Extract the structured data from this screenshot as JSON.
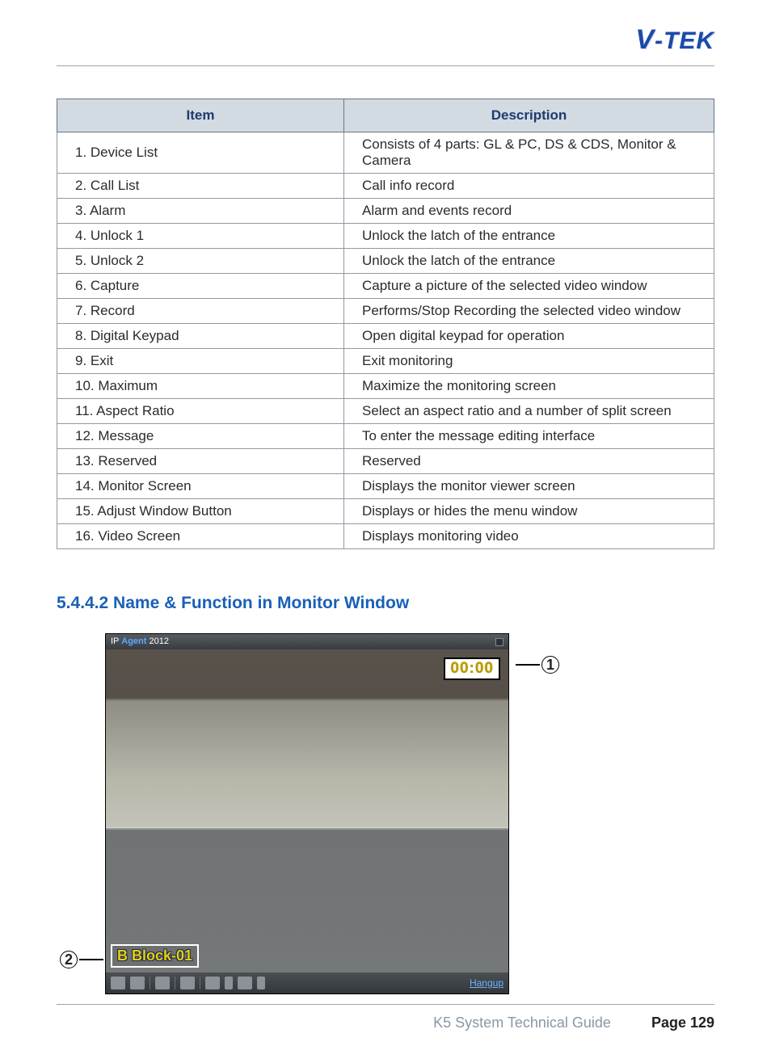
{
  "logo_text": "V-TEK",
  "table": {
    "headers": [
      "Item",
      "Description"
    ],
    "rows": [
      [
        "1. Device List",
        "Consists of 4 parts: GL & PC, DS & CDS, Monitor & Camera"
      ],
      [
        "2. Call List",
        "Call info record"
      ],
      [
        "3. Alarm",
        "Alarm and events record"
      ],
      [
        "4. Unlock 1",
        "Unlock the latch of the entrance"
      ],
      [
        "5. Unlock 2",
        "Unlock the latch of the entrance"
      ],
      [
        "6. Capture",
        "Capture a picture of the selected video window"
      ],
      [
        "7. Record",
        "Performs/Stop Recording the selected video window"
      ],
      [
        "8. Digital Keypad",
        "Open digital keypad for operation"
      ],
      [
        "9. Exit",
        "Exit monitoring"
      ],
      [
        "10. Maximum",
        "Maximize the monitoring screen"
      ],
      [
        "11. Aspect Ratio",
        "Select an aspect ratio and a number of split screen"
      ],
      [
        "12. Message",
        "To enter the message editing interface"
      ],
      [
        "13. Reserved",
        "Reserved"
      ],
      [
        "14. Monitor Screen",
        "Displays the monitor viewer screen"
      ],
      [
        "15. Adjust Window Button",
        "Displays or hides the menu window"
      ],
      [
        "16. Video Screen",
        "Displays monitoring video"
      ]
    ]
  },
  "section_heading": "5.4.4.2 Name & Function in Monitor Window",
  "monitor": {
    "app_title_prefix": "IP ",
    "app_title_agent": "Agent",
    "app_title_suffix": " 2012",
    "timer": "00:00",
    "location": "B Block-01",
    "hangup": "Hangup"
  },
  "callouts": {
    "c1": "1",
    "c2": "2"
  },
  "footer": {
    "guide": "K5 System Technical Guide",
    "page_label": "Page 129"
  }
}
